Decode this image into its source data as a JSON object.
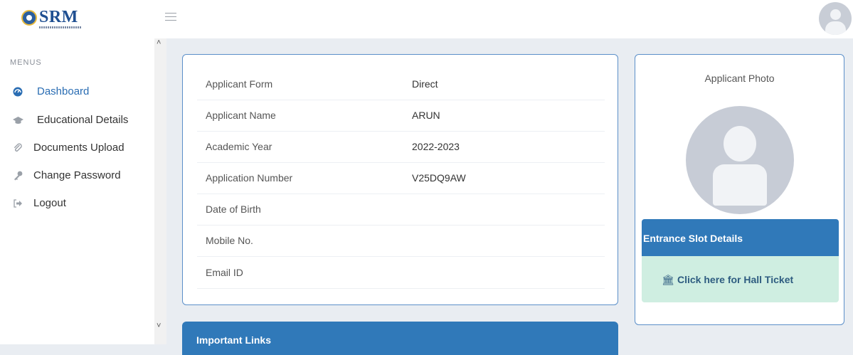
{
  "header": {
    "logo_text": "SRM",
    "menu_icon": "hamburger-icon",
    "avatar_icon": "user-avatar-icon"
  },
  "sidebar": {
    "section_label": "MENUS",
    "items": [
      {
        "label": "Dashboard",
        "icon": "dashboard-icon",
        "active": true
      },
      {
        "label": "Educational Details",
        "icon": "graduation-cap-icon",
        "active": false
      },
      {
        "label": "Documents Upload",
        "icon": "paperclip-icon",
        "active": false
      },
      {
        "label": "Change Password",
        "icon": "key-icon",
        "active": false
      },
      {
        "label": "Logout",
        "icon": "logout-icon",
        "active": false
      }
    ]
  },
  "applicant": {
    "rows": [
      {
        "key": "Applicant Form",
        "value": "Direct"
      },
      {
        "key": "Applicant Name",
        "value": "ARUN"
      },
      {
        "key": "Academic Year",
        "value": "2022-2023"
      },
      {
        "key": "Application Number",
        "value": "V25DQ9AW"
      },
      {
        "key": "Date of Birth",
        "value": ""
      },
      {
        "key": "Mobile No.",
        "value": ""
      },
      {
        "key": "Email ID",
        "value": ""
      }
    ]
  },
  "photo_panel": {
    "title": "Applicant Photo",
    "slot_title": "Entrance Slot Details",
    "hall_ticket_label": "Click here for Hall Ticket"
  },
  "links_panel": {
    "title": "Important Links"
  },
  "colors": {
    "accent": "#3079b9",
    "active_menu": "#2a6db3",
    "success_bg": "#cfeee1"
  }
}
